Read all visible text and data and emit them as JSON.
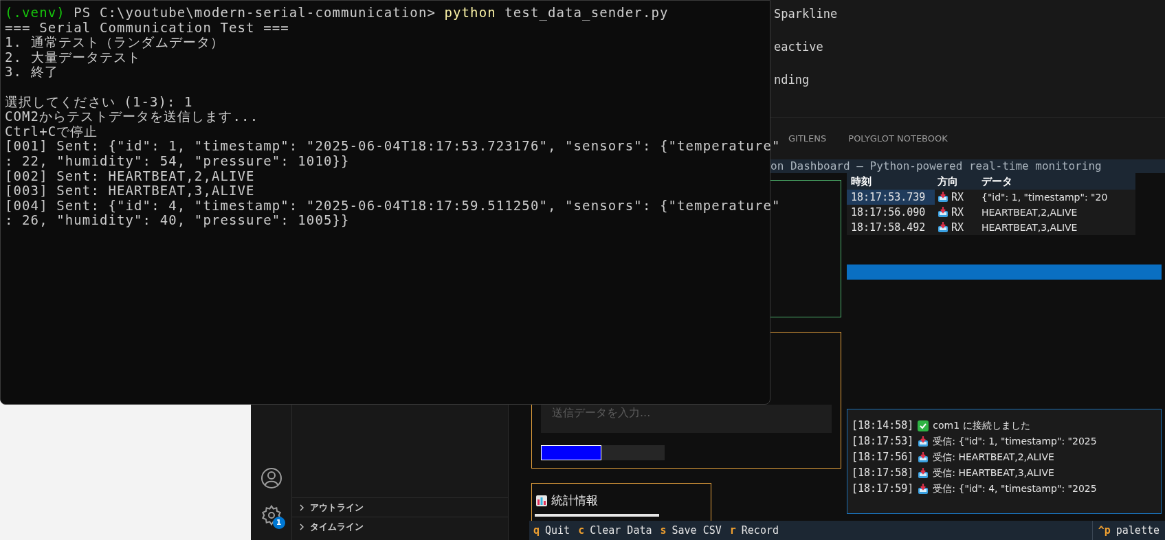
{
  "terminal": {
    "prompt": {
      "venv": "(.venv)",
      "path": "PS C:\\youtube\\modern-serial-communication>",
      "command": "python",
      "args": "test_data_sender.py"
    },
    "blocks": [
      [
        "=== Serial Communication Test ===",
        "1. 通常テスト（ランダムデータ）",
        "2. 大量データテスト",
        "3. 終了"
      ],
      [
        "選択してください (1-3): 1",
        "COM2からテストデータを送信します...",
        "Ctrl+Cで停止",
        "[001] Sent: {\"id\": 1, \"timestamp\": \"2025-06-04T18:17:53.723176\", \"sensors\": {\"temperature\"",
        ": 22, \"humidity\": 54, \"pressure\": 1010}}",
        "[002] Sent: HEARTBEAT,2,ALIVE",
        "[003] Sent: HEARTBEAT,3,ALIVE",
        "[004] Sent: {\"id\": 4, \"timestamp\": \"2025-06-04T18:17:59.511250\", \"sensors\": {\"temperature\"",
        ": 26, \"humidity\": 40, \"pressure\": 1005}}"
      ]
    ]
  },
  "editor": {
    "lines": [
      "Sparkline",
      "eactive",
      "nding"
    ]
  },
  "panel_tabs": [
    "GITLENS",
    "POLYGLOT NOTEBOOK"
  ],
  "sidebar": {
    "sections": [
      {
        "label": "アウトライン",
        "expanded": false
      },
      {
        "label": "タイムライン",
        "expanded": false
      }
    ]
  },
  "activity_bar": {
    "settings_badge": "1"
  },
  "app": {
    "header": "on Dashboard — Python-powered real-time monitoring",
    "send_input": {
      "placeholder": "送信データを入力..."
    },
    "send_progress": {
      "level": 0.49
    },
    "stats": {
      "title": "統計情報"
    },
    "table": {
      "columns": [
        "時刻",
        "方向",
        "データ"
      ],
      "rows": [
        {
          "time": "18:17:53.739",
          "direction": "RX",
          "data": "{\"id\": 1, \"timestamp\": \"20",
          "selected": true
        },
        {
          "time": "18:17:56.090",
          "direction": "RX",
          "data": "HEARTBEAT,2,ALIVE",
          "selected": false
        },
        {
          "time": "18:17:58.492",
          "direction": "RX",
          "data": "HEARTBEAT,3,ALIVE",
          "selected": false
        }
      ]
    },
    "log": [
      {
        "time": "[18:14:58]",
        "kind": "connected",
        "text": "com1 に接続しました"
      },
      {
        "time": "[18:17:53]",
        "kind": "received",
        "text": "受信: {\"id\": 1, \"timestamp\": \"2025"
      },
      {
        "time": "[18:17:56]",
        "kind": "received",
        "text": "受信: HEARTBEAT,2,ALIVE"
      },
      {
        "time": "[18:17:58]",
        "kind": "received",
        "text": "受信: HEARTBEAT,3,ALIVE"
      },
      {
        "time": "[18:17:59]",
        "kind": "received",
        "text": "受信: {\"id\": 4, \"timestamp\": \"2025"
      }
    ],
    "footer": {
      "keys": [
        {
          "key": "q",
          "label": "Quit"
        },
        {
          "key": "c",
          "label": "Clear Data"
        },
        {
          "key": "s",
          "label": "Save CSV"
        },
        {
          "key": "r",
          "label": "Record"
        }
      ],
      "palette": {
        "key": "^p",
        "label": "palette"
      }
    }
  }
}
